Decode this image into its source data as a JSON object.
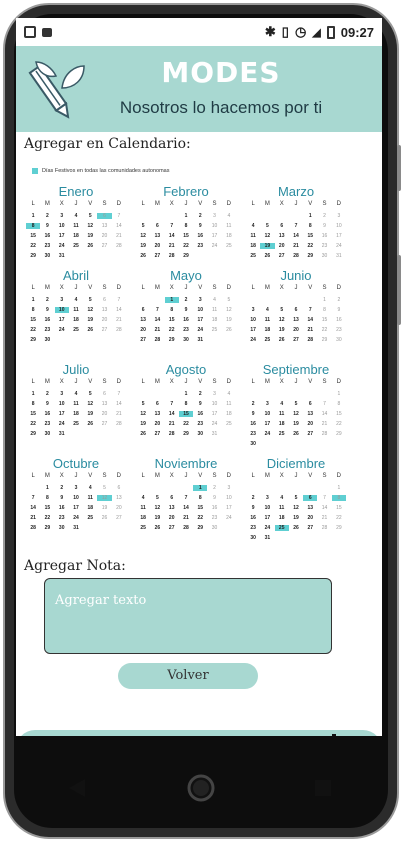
{
  "status_bar": {
    "time": "09:27"
  },
  "header": {
    "app_title": "MODES",
    "subtitle": "Nosotros lo hacemos por ti"
  },
  "calendar": {
    "section_title": "Agregar en Calendario:",
    "legend_label": "Días Festivos en todas las comunidades autonomas",
    "weekdays": [
      "L",
      "M",
      "X",
      "J",
      "V",
      "S",
      "D"
    ],
    "months": [
      {
        "name": "Enero",
        "offset": 0,
        "days": 31,
        "highlight": [
          6,
          8
        ]
      },
      {
        "name": "Febrero",
        "offset": 3,
        "days": 29,
        "highlight": []
      },
      {
        "name": "Marzo",
        "offset": 4,
        "days": 31,
        "highlight": [
          19
        ]
      },
      {
        "name": "Abril",
        "offset": 0,
        "days": 30,
        "highlight": [
          10
        ]
      },
      {
        "name": "Mayo",
        "offset": 2,
        "days": 31,
        "highlight": [
          1
        ]
      },
      {
        "name": "Junio",
        "offset": 5,
        "days": 30,
        "highlight": []
      },
      {
        "name": "Julio",
        "offset": 0,
        "days": 31,
        "highlight": []
      },
      {
        "name": "Agosto",
        "offset": 3,
        "days": 31,
        "highlight": [
          15
        ]
      },
      {
        "name": "Septiembre",
        "offset": 6,
        "days": 30,
        "highlight": []
      },
      {
        "name": "Octubre",
        "offset": 1,
        "days": 31,
        "highlight": [
          12
        ]
      },
      {
        "name": "Noviembre",
        "offset": 4,
        "days": 30,
        "highlight": [
          1
        ]
      },
      {
        "name": "Diciembre",
        "offset": 6,
        "days": 31,
        "highlight": [
          6,
          8,
          25
        ]
      }
    ]
  },
  "note": {
    "section_title": "Agregar Nota:",
    "placeholder": "Agregar texto"
  },
  "back_button": {
    "label": "Volver"
  },
  "nav": {
    "items": [
      {
        "icon": "home-icon"
      },
      {
        "icon": "gallery-icon"
      },
      {
        "icon": "graduation-cap-icon"
      },
      {
        "icon": "calendar-icon",
        "active": true
      },
      {
        "icon": "settings-gear-icon"
      }
    ]
  },
  "colors": {
    "accent": "#a8d8d1",
    "highlight": "#5fcfd2",
    "month_title": "#2b8ca0",
    "active_nav": "#2a7be4"
  }
}
